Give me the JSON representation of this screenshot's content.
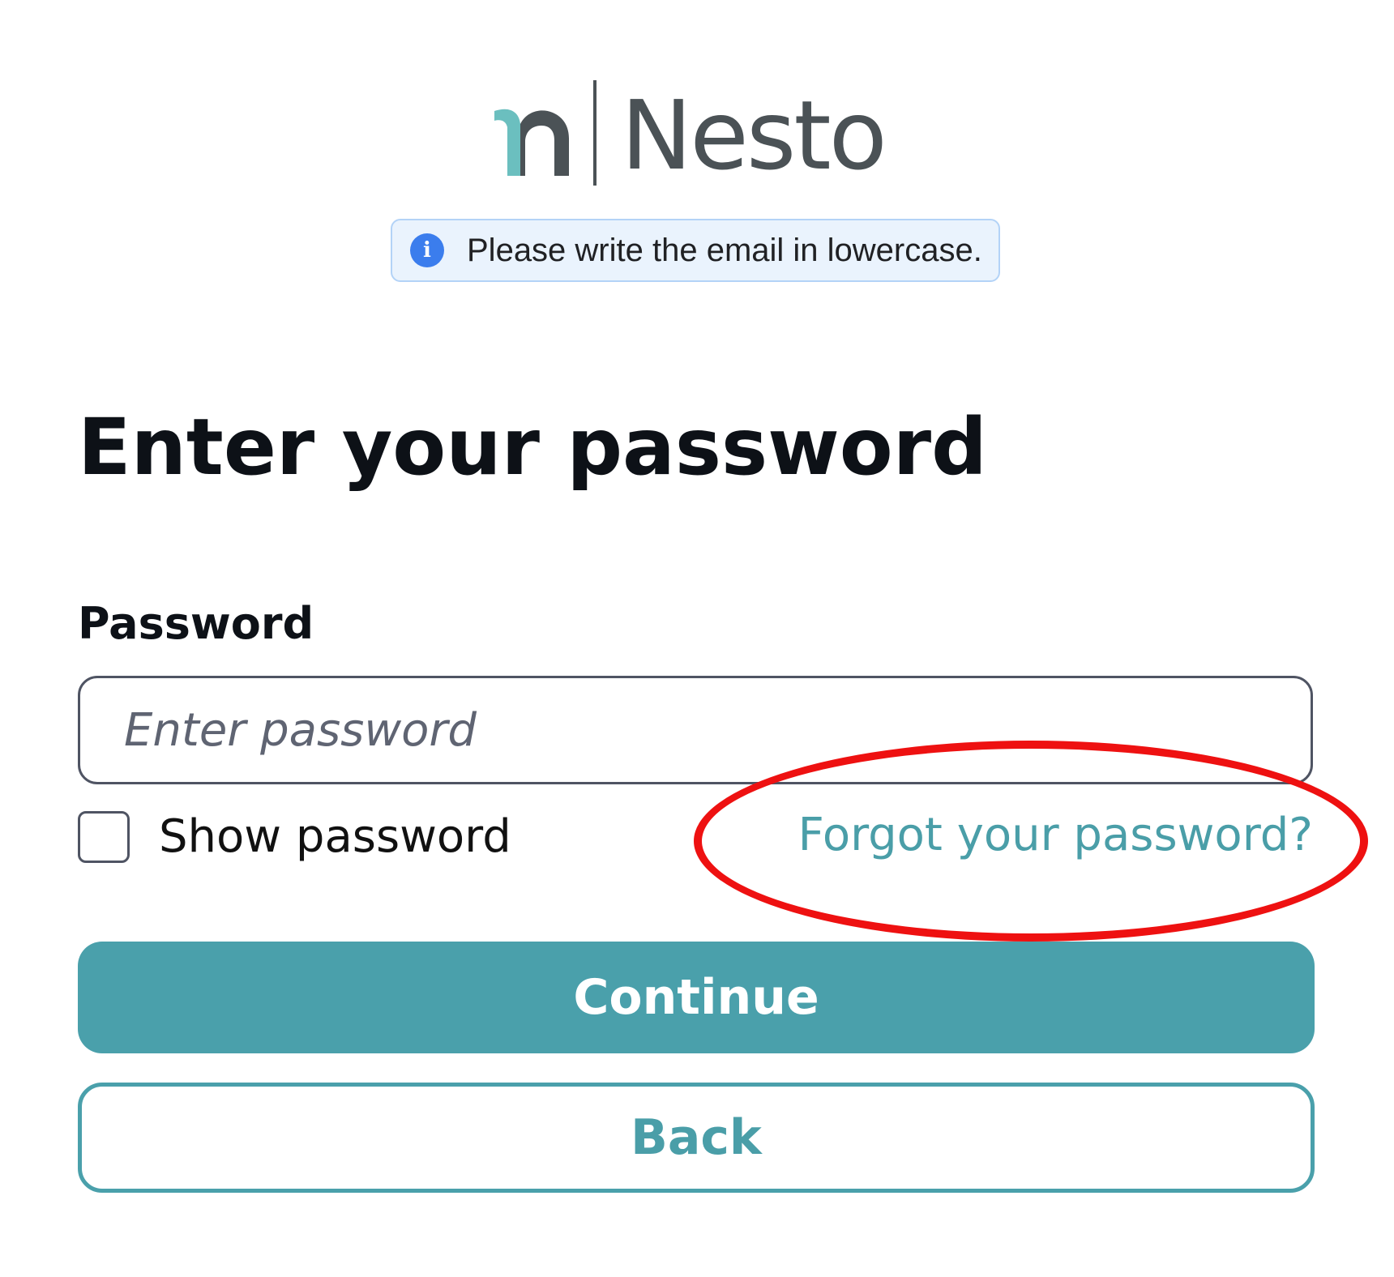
{
  "brand": {
    "name": "Nesto",
    "mark_color": "#6bbfbf",
    "text_color": "#4b5256"
  },
  "info_banner": {
    "icon": "info-icon",
    "text": "Please write the email in lowercase."
  },
  "heading": "Enter your password",
  "password_field": {
    "label": "Password",
    "placeholder": "Enter password",
    "value": ""
  },
  "show_password": {
    "label": "Show password",
    "checked": false
  },
  "forgot_link": "Forgot your password?",
  "buttons": {
    "continue_label": "Continue",
    "back_label": "Back"
  },
  "colors": {
    "accent": "#4aa0ab",
    "annotation": "#ee1111",
    "info_background": "#eaf3fd",
    "info_icon": "#3b7ded"
  }
}
